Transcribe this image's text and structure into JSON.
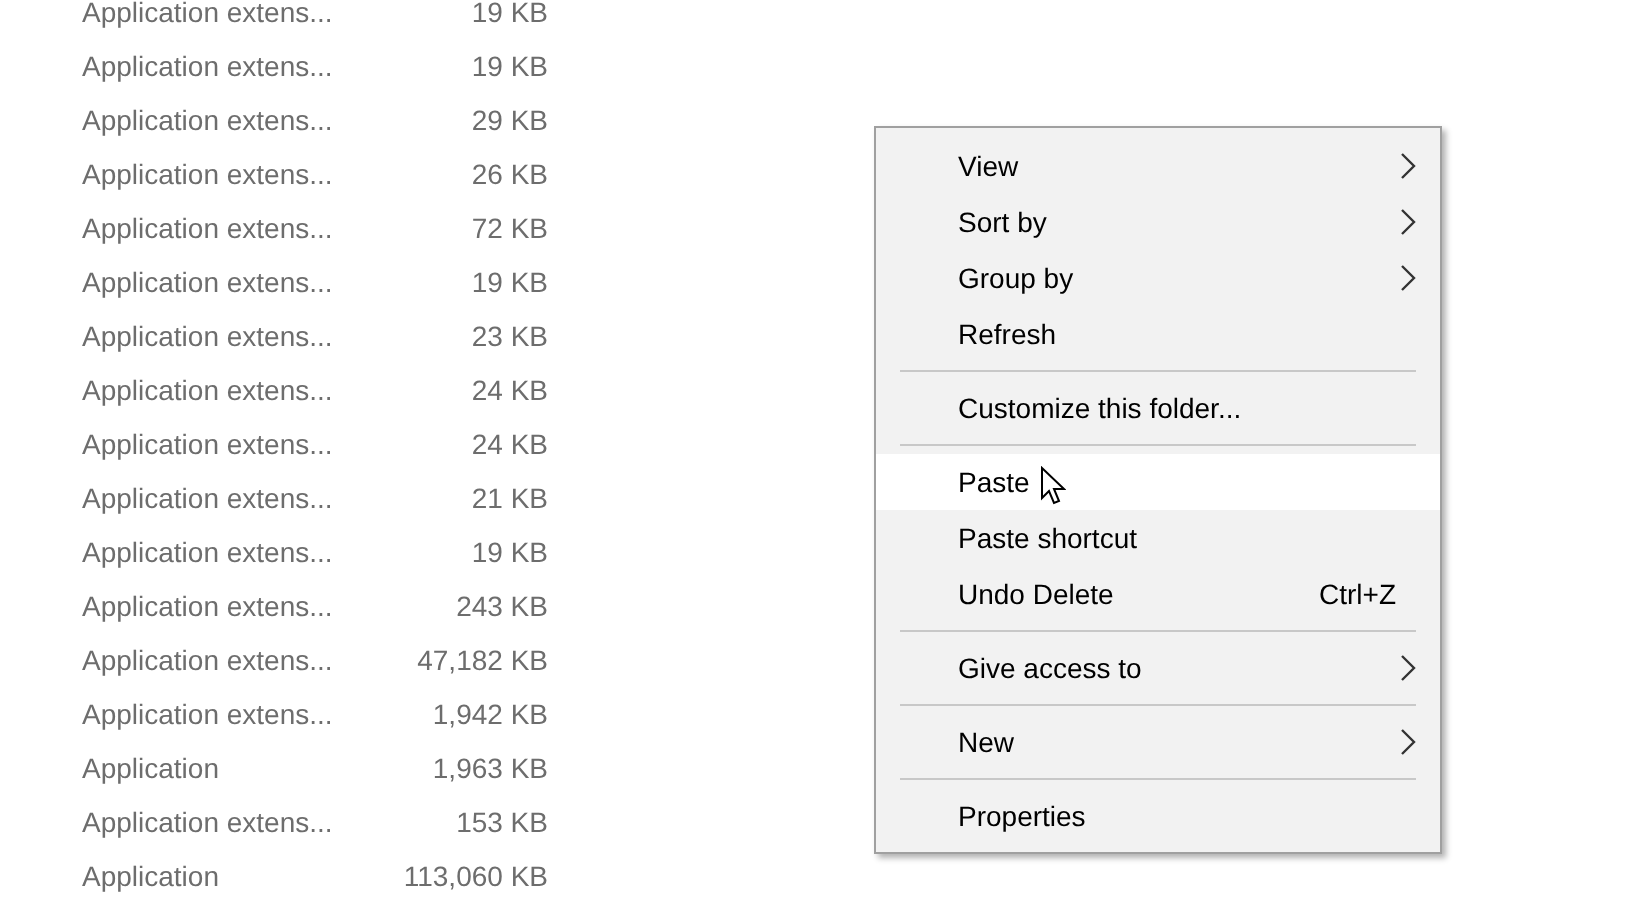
{
  "files": [
    {
      "type": "Application extens...",
      "size": "19 KB"
    },
    {
      "type": "Application extens...",
      "size": "19 KB"
    },
    {
      "type": "Application extens...",
      "size": "29 KB"
    },
    {
      "type": "Application extens...",
      "size": "26 KB"
    },
    {
      "type": "Application extens...",
      "size": "72 KB"
    },
    {
      "type": "Application extens...",
      "size": "19 KB"
    },
    {
      "type": "Application extens...",
      "size": "23 KB"
    },
    {
      "type": "Application extens...",
      "size": "24 KB"
    },
    {
      "type": "Application extens...",
      "size": "24 KB"
    },
    {
      "type": "Application extens...",
      "size": "21 KB"
    },
    {
      "type": "Application extens...",
      "size": "19 KB"
    },
    {
      "type": "Application extens...",
      "size": "243 KB"
    },
    {
      "type": "Application extens...",
      "size": "47,182 KB"
    },
    {
      "type": "Application extens...",
      "size": "1,942 KB"
    },
    {
      "type": "Application",
      "size": "1,963 KB"
    },
    {
      "type": "Application extens...",
      "size": "153 KB"
    },
    {
      "type": "Application",
      "size": "113,060 KB"
    }
  ],
  "context_menu": [
    {
      "kind": "item",
      "label": "View",
      "submenu": true,
      "selected": false
    },
    {
      "kind": "item",
      "label": "Sort by",
      "submenu": true,
      "selected": false
    },
    {
      "kind": "item",
      "label": "Group by",
      "submenu": true,
      "selected": false
    },
    {
      "kind": "item",
      "label": "Refresh",
      "submenu": false,
      "selected": false
    },
    {
      "kind": "separator"
    },
    {
      "kind": "item",
      "label": "Customize this folder...",
      "submenu": false,
      "selected": false
    },
    {
      "kind": "separator"
    },
    {
      "kind": "item",
      "label": "Paste",
      "submenu": false,
      "selected": true
    },
    {
      "kind": "item",
      "label": "Paste shortcut",
      "submenu": false,
      "selected": false
    },
    {
      "kind": "item",
      "label": "Undo Delete",
      "shortcut": "Ctrl+Z",
      "submenu": false,
      "selected": false
    },
    {
      "kind": "separator"
    },
    {
      "kind": "item",
      "label": "Give access to",
      "submenu": true,
      "selected": false
    },
    {
      "kind": "separator"
    },
    {
      "kind": "item",
      "label": "New",
      "submenu": true,
      "selected": false
    },
    {
      "kind": "separator"
    },
    {
      "kind": "item",
      "label": "Properties",
      "submenu": false,
      "selected": false
    }
  ]
}
